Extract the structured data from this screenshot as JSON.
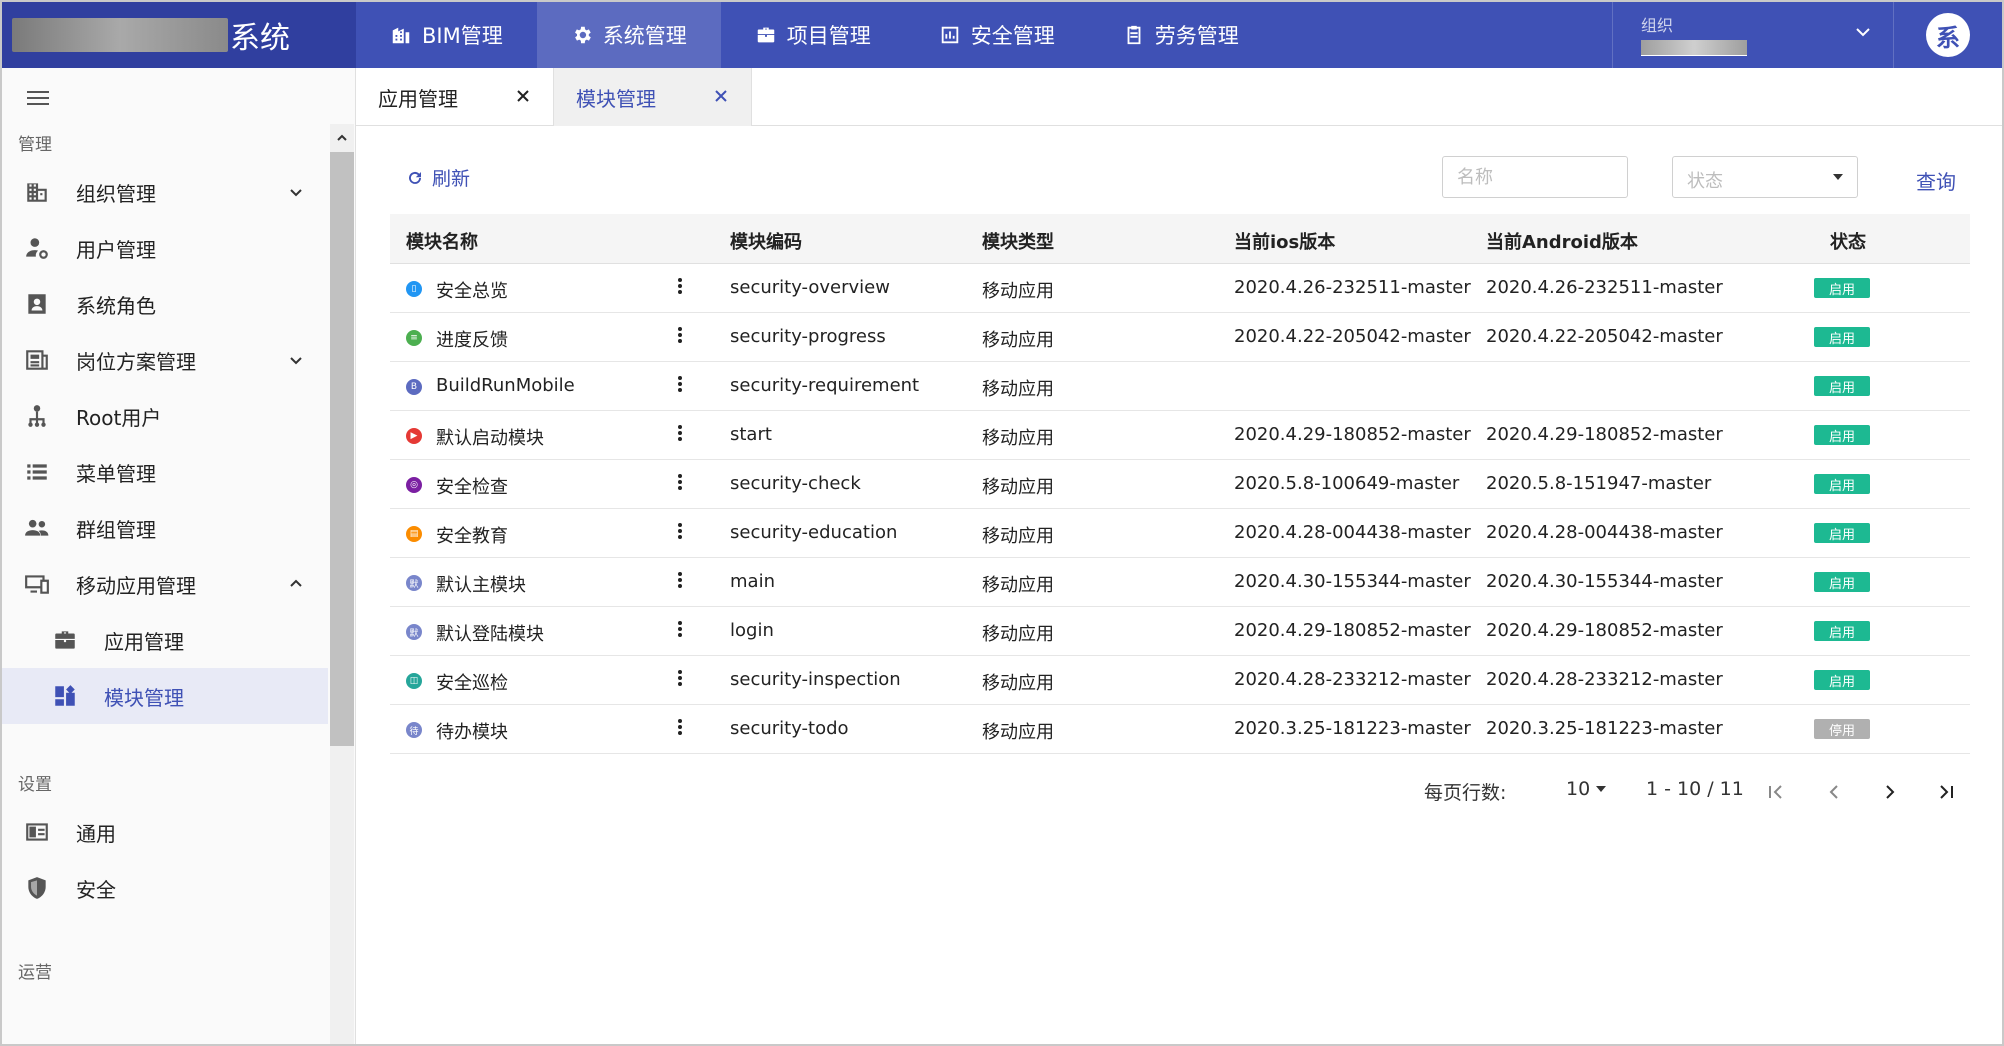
{
  "header": {
    "brand_text": "系统",
    "nav": [
      {
        "label": "BIM管理",
        "icon": "building-icon"
      },
      {
        "label": "系统管理",
        "icon": "gear-icon",
        "active": true
      },
      {
        "label": "项目管理",
        "icon": "briefcase-icon"
      },
      {
        "label": "安全管理",
        "icon": "chart-box-icon"
      },
      {
        "label": "劳务管理",
        "icon": "clipboard-icon"
      }
    ],
    "org_label": "组织",
    "avatar_text": "系",
    "colors": {
      "primary": "#3f51b5",
      "brand_bg": "#303f9f",
      "active_nav": "#5c6bc0"
    }
  },
  "sidebar": {
    "sections": {
      "manage": "管理",
      "settings": "设置",
      "ops": "运营"
    },
    "items": [
      {
        "label": "组织管理",
        "icon": "organization-icon",
        "expandable": true
      },
      {
        "label": "用户管理",
        "icon": "users-cog-icon"
      },
      {
        "label": "系统角色",
        "icon": "badge-icon"
      },
      {
        "label": "岗位方案管理",
        "icon": "newspaper-icon",
        "expandable": true
      },
      {
        "label": "Root用户",
        "icon": "sitemap-icon"
      },
      {
        "label": "菜单管理",
        "icon": "list-icon"
      },
      {
        "label": "群组管理",
        "icon": "group-icon"
      },
      {
        "label": "移动应用管理",
        "icon": "devices-icon",
        "expanded": true
      },
      {
        "label": "应用管理",
        "icon": "briefcase-icon"
      },
      {
        "label": "模块管理",
        "icon": "dashboard-add-icon",
        "active": true
      }
    ],
    "settings_items": [
      {
        "label": "通用",
        "icon": "panel-icon"
      },
      {
        "label": "安全",
        "icon": "shield-icon"
      }
    ]
  },
  "tabs": [
    {
      "label": "应用管理"
    },
    {
      "label": "模块管理",
      "active": true
    }
  ],
  "toolbar": {
    "refresh_label": "刷新",
    "name_placeholder": "名称",
    "status_placeholder": "状态",
    "query_label": "查询"
  },
  "table": {
    "columns": [
      "模块名称",
      "模块编码",
      "模块类型",
      "当前ios版本",
      "当前Android版本",
      "状态"
    ],
    "rows": [
      {
        "name": "安全总览",
        "icon_color": "#2196f3",
        "icon_char": "▯",
        "code": "security-overview",
        "type": "移动应用",
        "ios": "2020.4.26-232511-master",
        "android": "2020.4.26-232511-master",
        "status": "启用"
      },
      {
        "name": "进度反馈",
        "icon_color": "#4caf50",
        "icon_char": "≡",
        "code": "security-progress",
        "type": "移动应用",
        "ios": "2020.4.22-205042-master",
        "android": "2020.4.22-205042-master",
        "status": "启用"
      },
      {
        "name": "BuildRunMobile",
        "icon_color": "#5c6bc0",
        "icon_char": "B",
        "code": "security-requirement",
        "type": "移动应用",
        "ios": "",
        "android": "",
        "status": "启用"
      },
      {
        "name": "默认启动模块",
        "icon_color": "#e53935",
        "icon_char": "▶",
        "code": "start",
        "type": "移动应用",
        "ios": "2020.4.29-180852-master",
        "android": "2020.4.29-180852-master",
        "status": "启用"
      },
      {
        "name": "安全检查",
        "icon_color": "#7b1fa2",
        "icon_char": "◎",
        "code": "security-check",
        "type": "移动应用",
        "ios": "2020.5.8-100649-master",
        "android": "2020.5.8-151947-master",
        "status": "启用"
      },
      {
        "name": "安全教育",
        "icon_color": "#fb8c00",
        "icon_char": "▤",
        "code": "security-education",
        "type": "移动应用",
        "ios": "2020.4.28-004438-master",
        "android": "2020.4.28-004438-master",
        "status": "启用"
      },
      {
        "name": "默认主模块",
        "icon_color": "#7986cb",
        "icon_char": "默",
        "code": "main",
        "type": "移动应用",
        "ios": "2020.4.30-155344-master",
        "android": "2020.4.30-155344-master",
        "status": "启用"
      },
      {
        "name": "默认登陆模块",
        "icon_color": "#7986cb",
        "icon_char": "默",
        "code": "login",
        "type": "移动应用",
        "ios": "2020.4.29-180852-master",
        "android": "2020.4.29-180852-master",
        "status": "启用"
      },
      {
        "name": "安全巡检",
        "icon_color": "#26a69a",
        "icon_char": "◫",
        "code": "security-inspection",
        "type": "移动应用",
        "ios": "2020.4.28-233212-master",
        "android": "2020.4.28-233212-master",
        "status": "启用"
      },
      {
        "name": "待办模块",
        "icon_color": "#7986cb",
        "icon_char": "待",
        "code": "security-todo",
        "type": "移动应用",
        "ios": "2020.3.25-181223-master",
        "android": "2020.3.25-181223-master",
        "status": "停用"
      }
    ],
    "status_colors": {
      "启用": "#1db992",
      "停用": "#b0b0b0"
    }
  },
  "pagination": {
    "rows_per_page_label": "每页行数:",
    "rows_per_page": "10",
    "range": "1 - 10 / 11"
  }
}
